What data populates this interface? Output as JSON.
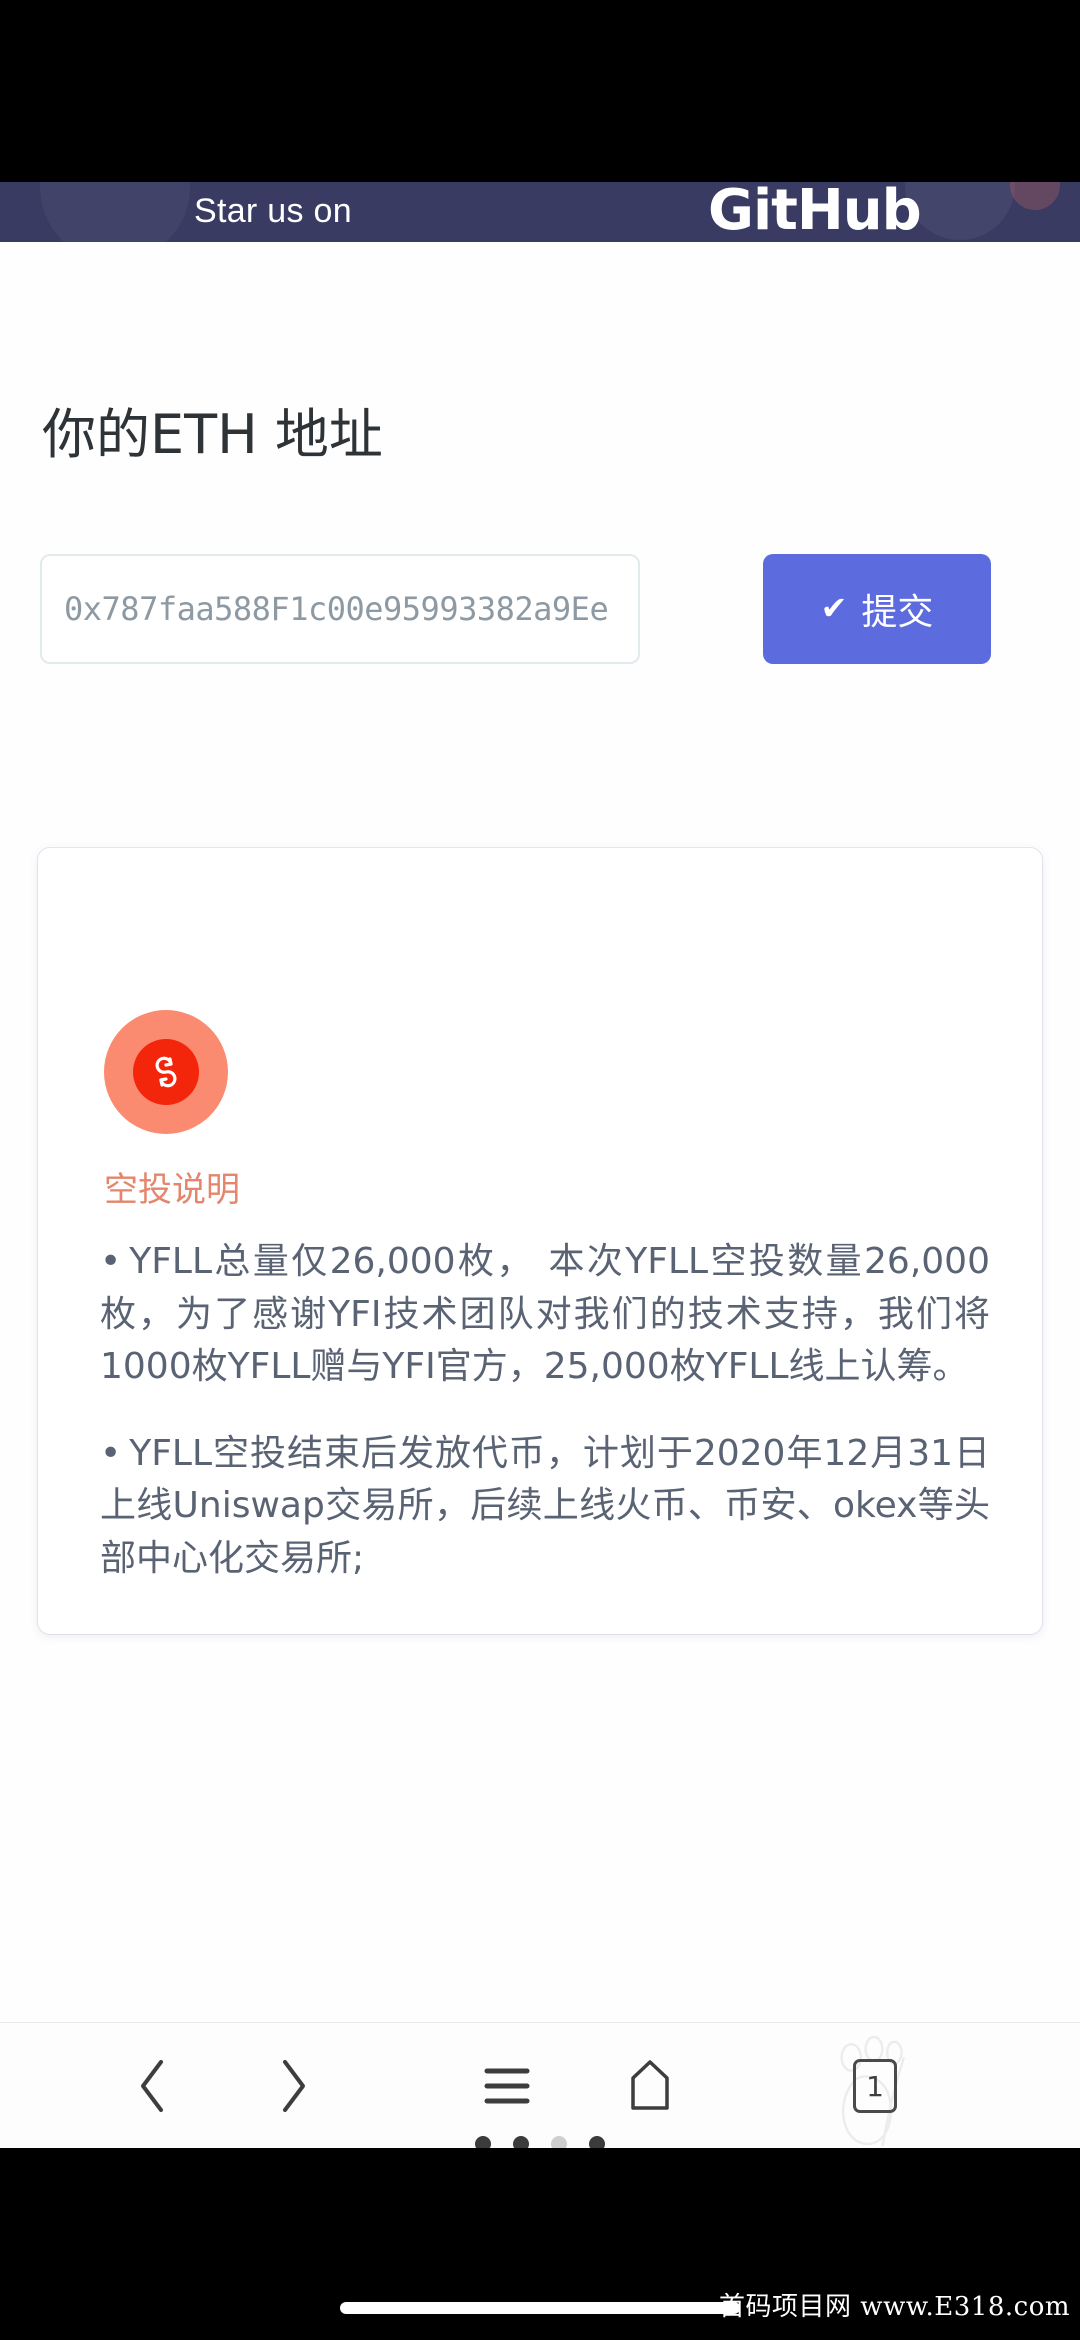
{
  "banner": {
    "star_text": "Star us on",
    "logo_text": "GitHub",
    "background_color": "#393b63"
  },
  "page": {
    "heading": "你的ETH 地址",
    "background_color": "#fefeff"
  },
  "form": {
    "address_input": {
      "value": "",
      "placeholder": "0x787faa588F1c00e95993382a9Ee"
    },
    "submit": {
      "label": "提交",
      "icon": "check-icon",
      "color": "#5c6bdd"
    }
  },
  "card": {
    "icon_name": "swap-dollar-icon",
    "icon_outer_color": "#fb8b70",
    "icon_inner_color": "#f3260b",
    "title": "空投说明",
    "title_color": "#e4866d",
    "paragraphs": [
      {
        "bullet": "•",
        "text": "YFLL总量仅26,000枚， 本次YFLL空投数量26,000枚，为了感谢YFI技术团队对我们的技术支持，我们将1000枚YFLL赠与YFI官方，25,000枚YFLL线上认筹。"
      },
      {
        "bullet": "•",
        "text": "YFLL空投结束后发放代币，计划于2020年12月31日上线Uniswap交易所，后续上线火币、币安、okex等头部中心化交易所;"
      }
    ]
  },
  "browser_nav": {
    "back": "back-chevron-icon",
    "forward": "forward-chevron-icon",
    "menu": "hamburger-menu-icon",
    "home": "home-icon",
    "tabs_count": "1"
  },
  "page_dots": {
    "count": 4,
    "active_index": 2
  },
  "watermark": {
    "text": "首码项目网 www.E318.com"
  }
}
